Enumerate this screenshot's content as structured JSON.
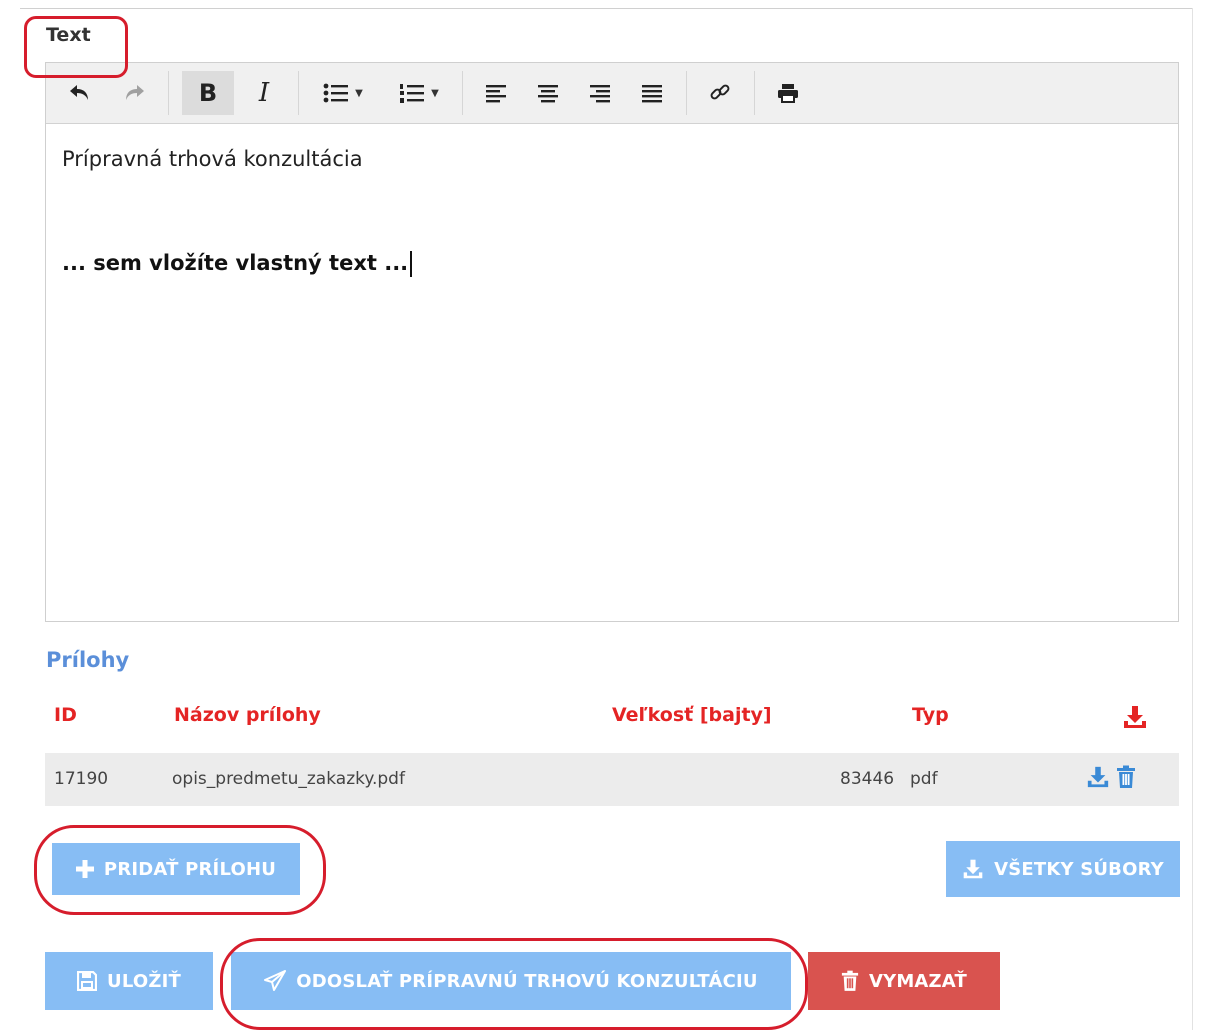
{
  "editor": {
    "label": "Text",
    "toolbar": {
      "undo": "undo-icon",
      "redo": "redo-icon",
      "bold": "B",
      "italic": "I",
      "bullet_list": "bullet-list-icon",
      "numbered_list": "numbered-list-icon",
      "align_left": "align-left-icon",
      "align_center": "align-center-icon",
      "align_right": "align-right-icon",
      "align_justify": "align-justify-icon",
      "link": "link-icon",
      "print": "print-icon"
    },
    "content": {
      "line1": "Prípravná trhová konzultácia",
      "line2": "... sem vložíte vlastný text ..."
    }
  },
  "attachments": {
    "title": "Prílohy",
    "columns": {
      "id": "ID",
      "name": "Názov prílohy",
      "size": "Veľkosť [bajty]",
      "type": "Typ"
    },
    "rows": [
      {
        "id": "17190",
        "name": "opis_predmetu_zakazky.pdf",
        "size": "83446",
        "type": "pdf"
      }
    ]
  },
  "buttons": {
    "add_attachment": "PRIDAŤ PRÍLOHU",
    "all_files": "VŠETKY SÚBORY",
    "save": "ULOŽIŤ",
    "send": "ODOSLAŤ PRÍPRAVNÚ TRHOVÚ KONZULTÁCIU",
    "delete": "VYMAZAŤ"
  },
  "colors": {
    "accent_blue": "#87bdf4",
    "header_red": "#e42424",
    "danger": "#d9534f",
    "section_blue": "#5b8fd9",
    "highlight_red": "#d61d2c"
  }
}
